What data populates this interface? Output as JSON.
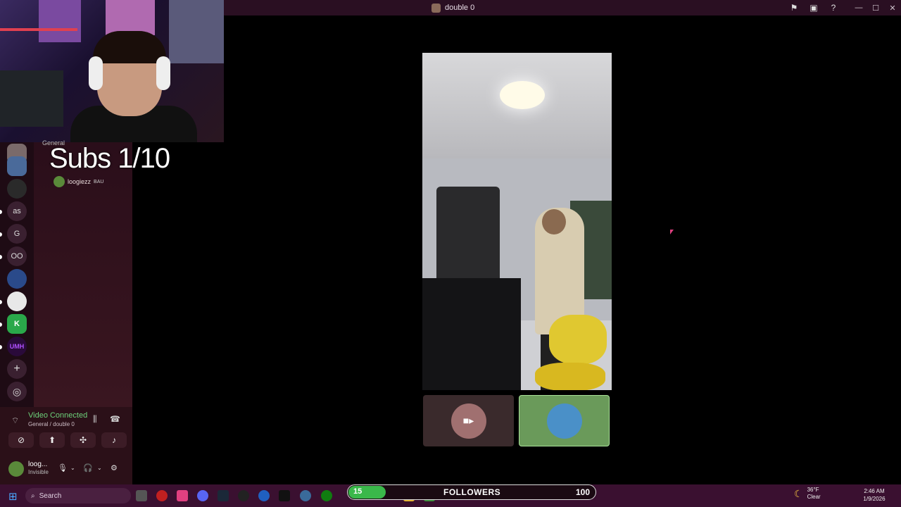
{
  "window": {
    "title": "double 0",
    "icons": [
      "flag-icon",
      "inbox-icon",
      "help-icon"
    ],
    "controls": [
      "minimize-icon",
      "maximize-icon",
      "close-icon"
    ]
  },
  "overlay": {
    "subs_text": "Subs 1/10",
    "channel_label": "General"
  },
  "servers": [
    {
      "label": ""
    },
    {
      "label": ""
    },
    {
      "label": ""
    },
    {
      "label": "as"
    },
    {
      "label": "G"
    },
    {
      "label": "OO"
    },
    {
      "label": ""
    },
    {
      "label": ""
    },
    {
      "label": "K"
    },
    {
      "label": "UMH"
    },
    {
      "label": "+"
    },
    {
      "label": "◎"
    }
  ],
  "channel_users": [
    {
      "name": "loogiezz",
      "badge": "BAU"
    }
  ],
  "voice": {
    "status": "Video Connected",
    "location": "General / double 0"
  },
  "me": {
    "name": "loog...",
    "status": "Invisible"
  },
  "taskbar": {
    "search_placeholder": "Search",
    "followers": {
      "current": 15,
      "label": "FOLLOWERS",
      "goal": 100,
      "progress": 0.15
    },
    "weather": {
      "temp": "36°F",
      "condition": "Clear"
    },
    "clock": {
      "time": "2:46 AM",
      "date": "1/9/2026"
    }
  }
}
